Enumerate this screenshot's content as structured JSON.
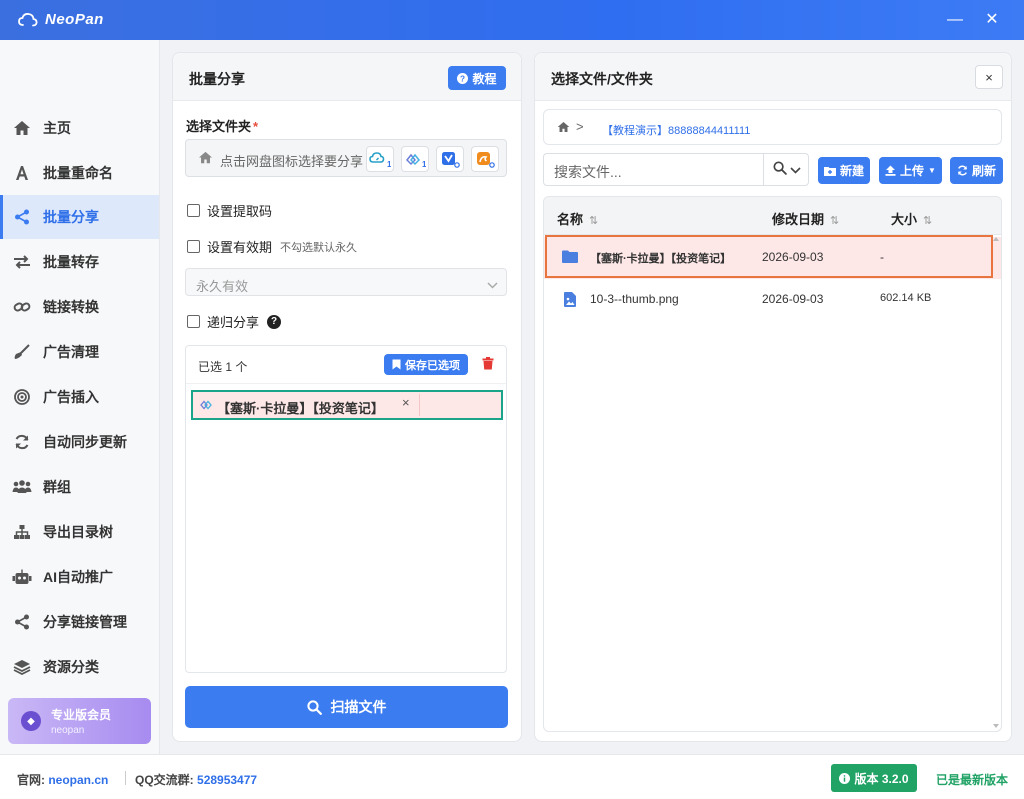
{
  "app": {
    "name": "NeoPan"
  },
  "sidebar": {
    "items": [
      {
        "label": "主页",
        "icon": "home-icon"
      },
      {
        "label": "批量重命名",
        "icon": "font-icon"
      },
      {
        "label": "批量分享",
        "icon": "share-icon",
        "active": true
      },
      {
        "label": "批量转存",
        "icon": "transfer-icon"
      },
      {
        "label": "链接转换",
        "icon": "link-icon"
      },
      {
        "label": "广告清理",
        "icon": "broom-icon"
      },
      {
        "label": "广告插入",
        "icon": "target-icon"
      },
      {
        "label": "自动同步更新",
        "icon": "sync-icon"
      },
      {
        "label": "群组",
        "icon": "users-icon"
      },
      {
        "label": "导出目录树",
        "icon": "sitemap-icon"
      },
      {
        "label": "AI自动推广",
        "icon": "robot-icon"
      },
      {
        "label": "分享链接管理",
        "icon": "share-icon"
      },
      {
        "label": "资源分类",
        "icon": "layers-icon"
      }
    ],
    "vip": {
      "title": "专业版会员",
      "subtitle": "neopan"
    }
  },
  "left_panel": {
    "title": "批量分享",
    "tutorial_label": "教程",
    "folder_label": "选择文件夹",
    "required_mark": "*",
    "folder_placeholder": "点击网盘图标选择要分享",
    "netdisks": [
      {
        "icon": "baidu-cloud-icon",
        "badge": "1"
      },
      {
        "icon": "ali-cloud-icon",
        "badge": "1"
      },
      {
        "icon": "xunlei-icon",
        "badge": "0"
      },
      {
        "icon": "uc-cloud-icon",
        "badge": "0"
      }
    ],
    "opt_code": "设置提取码",
    "opt_expire": "设置有效期",
    "opt_expire_hint": "不勾选默认永久",
    "expire_value": "永久有效",
    "opt_recursive": "递归分享",
    "help": "?",
    "selected_count": "已选 1 个",
    "save_selected": "保存已选项",
    "selected_items": [
      {
        "name": "【塞斯·卡拉曼】【投资笔记】",
        "remove": "×"
      }
    ],
    "scan_label": "扫描文件"
  },
  "right_panel": {
    "title": "选择文件/文件夹",
    "close": "×",
    "breadcrumb": {
      "sep": ">",
      "path": "【教程演示】88888844411111"
    },
    "search_placeholder": "搜索文件...",
    "buttons": {
      "new": "新建",
      "upload": "上传",
      "refresh": "刷新"
    },
    "columns": {
      "name": "名称",
      "modified": "修改日期",
      "size": "大小",
      "sort": "⇅"
    },
    "rows": [
      {
        "type": "folder",
        "name": "【塞斯·卡拉曼】【投资笔记】",
        "date": "2026-09-03",
        "size": "-"
      },
      {
        "type": "image",
        "name": "10-3--thumb.png",
        "date": "2026-09-03",
        "size": "602.14 KB"
      }
    ]
  },
  "footer": {
    "site_label": "官网:",
    "site": "neopan.cn",
    "qq_label": "QQ交流群:",
    "qq": "528953477",
    "version": "版本 3.2.0",
    "status": "已是最新版本"
  },
  "colors": {
    "accent": "#3b7cf0",
    "success": "#21a366",
    "highlight": "#fde7e7",
    "danger": "#e53935"
  }
}
